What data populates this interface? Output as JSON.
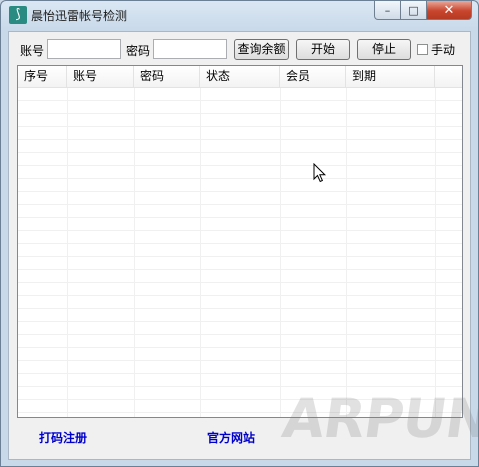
{
  "window": {
    "title": "晨怡迅雷帐号检测",
    "controls": {
      "minimize": "–",
      "maximize": "□",
      "close": "✕"
    }
  },
  "form": {
    "account_label": "账号",
    "account_value": "",
    "password_label": "密码",
    "password_value": "",
    "query_balance_button": "查询余额",
    "start_button": "开始",
    "stop_button": "停止",
    "manual_checkbox_label": "手动",
    "manual_checked": false
  },
  "table": {
    "columns": [
      "序号",
      "账号",
      "密码",
      "状态",
      "会员",
      "到期"
    ],
    "rows": []
  },
  "footer": {
    "register_link": "打码注册",
    "website_link": "官方网站"
  },
  "watermark": "ARPUN",
  "icons": {
    "app": "app-icon",
    "cursor": "mouse-pointer-icon"
  }
}
